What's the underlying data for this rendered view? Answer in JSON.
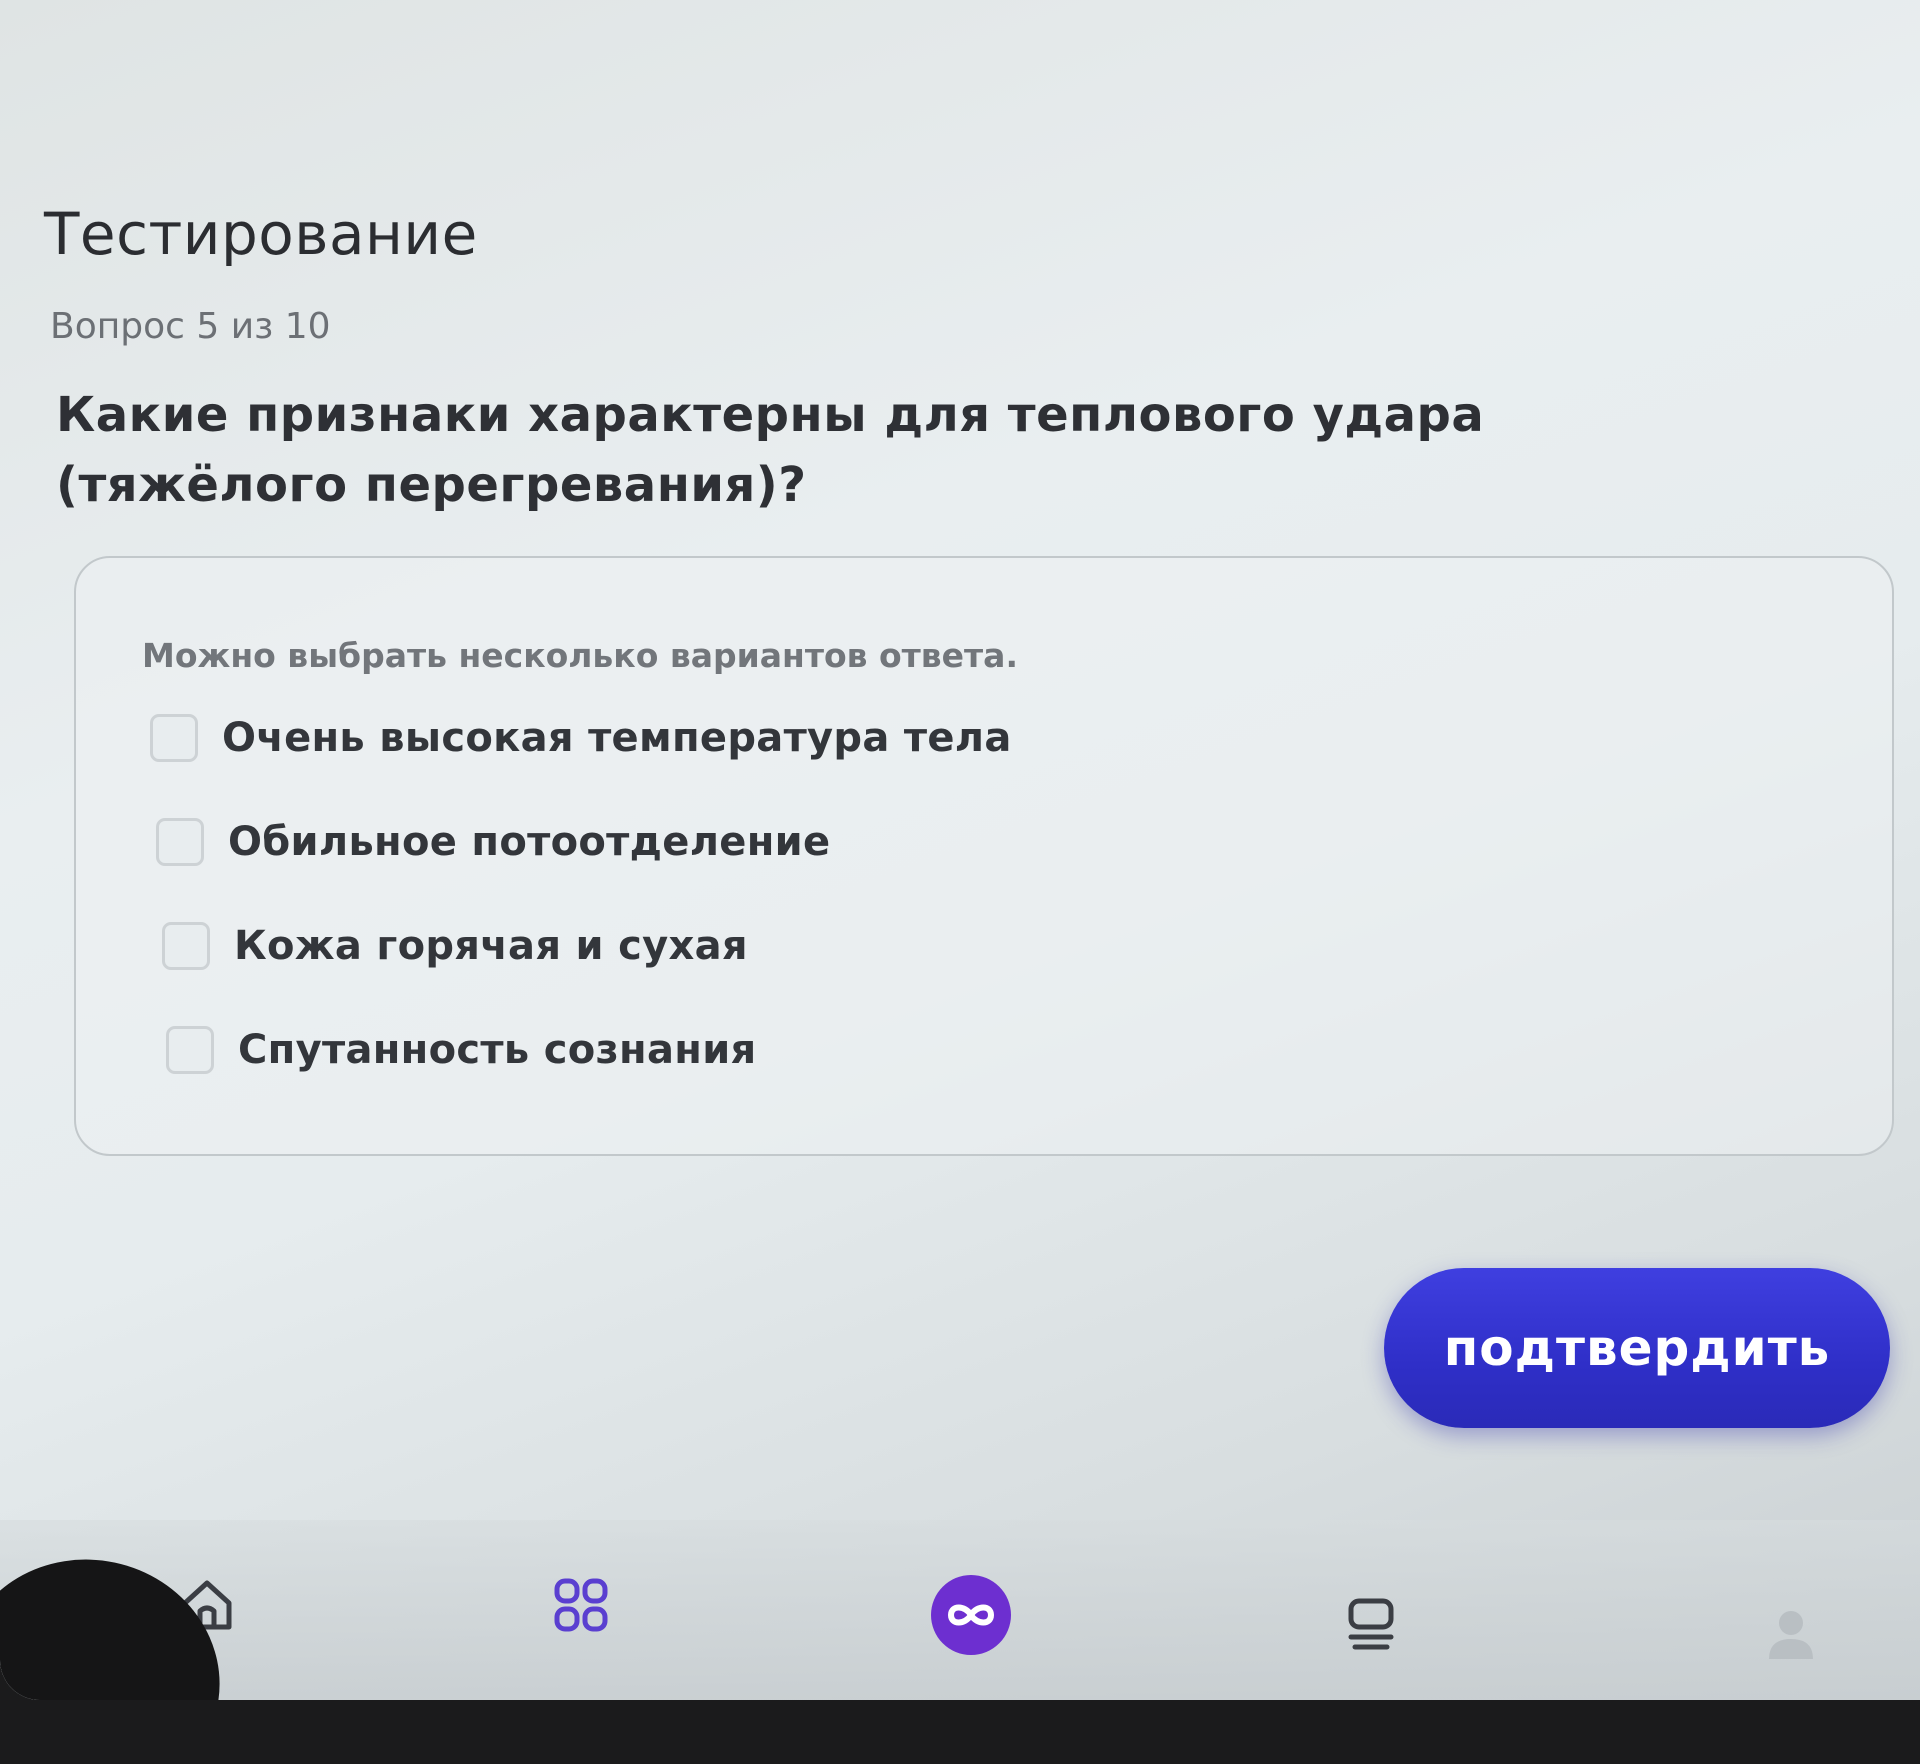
{
  "header": {
    "title": "Тестирование",
    "counter": "Вопрос 5 из 10"
  },
  "question": {
    "text": "Какие признаки характерны для теплового удара (тяжёлого перегревания)?",
    "hint": "Можно выбрать несколько вариантов ответа.",
    "options": [
      {
        "label": "Очень высокая температура тела",
        "checked": false
      },
      {
        "label": "Обильное потоотделение",
        "checked": false
      },
      {
        "label": "Кожа горячая и сухая",
        "checked": false
      },
      {
        "label": "Спутанность сознания",
        "checked": false
      }
    ]
  },
  "actions": {
    "confirm_label": "подтвердить"
  },
  "bottom_nav": {
    "items": [
      {
        "icon": "home-icon",
        "active": false
      },
      {
        "icon": "grid-icon",
        "active": false
      },
      {
        "icon": "infinity-icon",
        "active": true
      },
      {
        "icon": "list-icon",
        "active": false
      },
      {
        "icon": "profile-icon",
        "active": false
      }
    ]
  },
  "colors": {
    "accent": "#3535d4",
    "nav_active": "#6d2fd0",
    "text": "#2e3035",
    "muted": "#6c7075"
  }
}
